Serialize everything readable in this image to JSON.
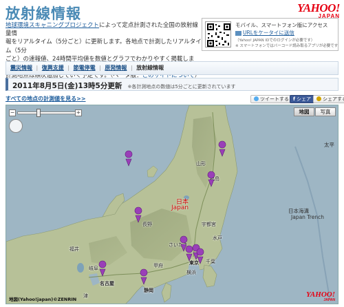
{
  "header": {
    "title": "放射線情報",
    "logo_text": "YAHOO!",
    "logo_sub": "JAPAN"
  },
  "intro": {
    "link_text": "地球環境スキャニングプロジェクト",
    "text_1": "によって定点計測された全国の放射線量情",
    "text_2": "報をリアルタイム（5分ごと）に更新します。各地点で計測したリアルタイム（5分",
    "text_3": "ごと）の速報値、24時間平均値を数値とグラフでわかりやすく掲載します。",
    "text_4": "計測地点は順次追加していく予定です。（ベータ版：",
    "about_link": "このサイトについて",
    "text_5": "）"
  },
  "mobile": {
    "title": "モバイル、スマートフォン版にアクセス",
    "url_link": "URLをケータイに送信",
    "note_1": "（Yahoo! JAPAN IDでのログインが必要です）",
    "note_2": "※ スマートフォンではバーコード読み取るアプリが必要です"
  },
  "nav": {
    "items": [
      "震災情報",
      "復興支援",
      "節電停電",
      "原発情報"
    ],
    "current": "放射線情報",
    "separator": "|"
  },
  "update": {
    "time": "2011年8月5日(金)13時5分更新",
    "note": "※各計測地点の数値は5分ごとに更新されています"
  },
  "links": {
    "all_points": "すべての地点の計測値を見る>>"
  },
  "social": {
    "tweet": "ツイートする",
    "share": "シェア",
    "mixi": "シェアする"
  },
  "map": {
    "tab_map": "地図",
    "tab_photo": "写真",
    "zoom_in": "+",
    "zoom_out": "−",
    "copyright": "地図(Yahoo!japan)©ZENRIN",
    "logo": "YAHOO!",
    "logo_sub": "JAPAN",
    "labels": {
      "japan_ja": "日本",
      "japan_en": "Japan",
      "taiheiyo": "太平",
      "nihon_kaiko": "日本海溝",
      "japan_trench": "Japan Trench",
      "tokyo": "東京",
      "nagoya": "名古屋",
      "shizuoka": "静岡",
      "nagano": "長野",
      "saitama": "さいたま",
      "yokohama": "横浜",
      "fukui": "福井",
      "gifu": "岐阜",
      "tsu": "津",
      "yamagata": "山形",
      "fukushima": "福島",
      "utsunomiya": "宇都宮",
      "mito": "水戸",
      "chiba": "千葉",
      "kofu": "甲府"
    }
  },
  "colors": {
    "title_blue": "#4a8ab5",
    "link_blue": "#1a5a9a",
    "yahoo_red": "#e60012",
    "marker_purple": "#9a3fb8",
    "sea": "#9eb6c4",
    "land": "#b7c198"
  }
}
